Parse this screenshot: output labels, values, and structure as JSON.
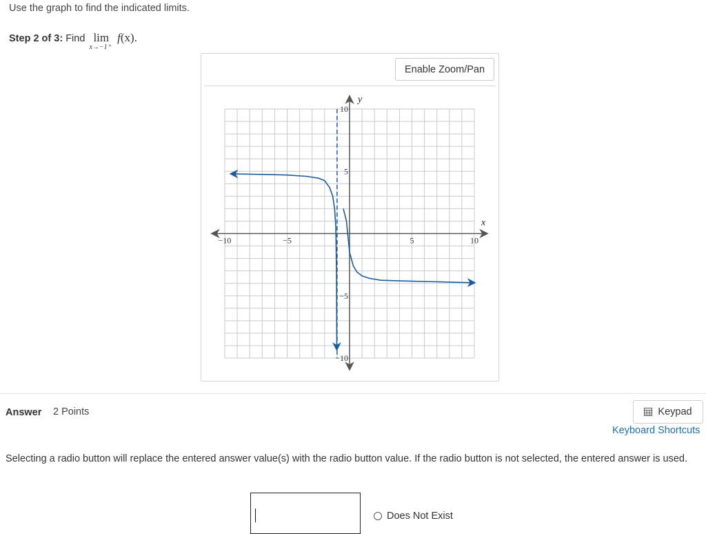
{
  "instructions": "Use the graph to find the indicated limits.",
  "step": {
    "label": "Step 2 of 3:",
    "find": "Find",
    "lim": "lim",
    "lim_sub": "x→−1⁺",
    "func_name": "f",
    "func_arg": "(x)."
  },
  "graph": {
    "zoom_button": "Enable Zoom/Pan",
    "x_axis_label": "x",
    "y_axis_label": "y",
    "x_ticks": [
      "−10",
      "−5",
      "5",
      "10"
    ],
    "y_ticks": [
      "10",
      "5",
      "−5",
      "−10"
    ],
    "curve_color": "#1a5b9e",
    "asymptote_color": "#1a5b9e",
    "axis_color": "#555555"
  },
  "answer": {
    "label": "Answer",
    "points": "2 Points",
    "keypad": "Keypad",
    "keyboard_shortcuts": "Keyboard Shortcuts",
    "note": "Selecting a radio button will replace the entered answer value(s) with the radio button value. If the radio button is not selected, the entered answer is used.",
    "input_value": "",
    "radio_option": "Does Not Exist"
  },
  "chart_data": {
    "type": "line",
    "xlim": [
      -10,
      10
    ],
    "ylim": [
      -10,
      10
    ],
    "grid": true,
    "x_tick_labels": [
      "−10",
      "−5",
      "5",
      "10"
    ],
    "y_tick_labels": [
      "10",
      "5",
      "−5",
      "−10"
    ],
    "xlabel": "x",
    "ylabel": "y",
    "vertical_asymptote_x": -1,
    "series": [
      {
        "x": [
          -9.5,
          -7,
          -5,
          -3.5,
          -2.5,
          -2.0,
          -1.6,
          -1.35,
          -1.2,
          -1.1,
          -1.05,
          -1.02
        ],
        "y": [
          4.8,
          4.75,
          4.7,
          4.6,
          4.45,
          4.25,
          3.7,
          3.0,
          2.0,
          0.5,
          -3.0,
          -9.3
        ]
      },
      {
        "x": [
          -0.5,
          -0.25,
          0,
          0.3,
          0.6,
          1.0,
          1.6,
          2.5,
          4.0,
          6.0,
          8.0,
          10.0
        ],
        "y": [
          2.0,
          1.0,
          -1.5,
          -2.6,
          -3.1,
          -3.4,
          -3.6,
          -3.75,
          -3.8,
          -3.85,
          -3.9,
          -3.95
        ]
      }
    ]
  }
}
